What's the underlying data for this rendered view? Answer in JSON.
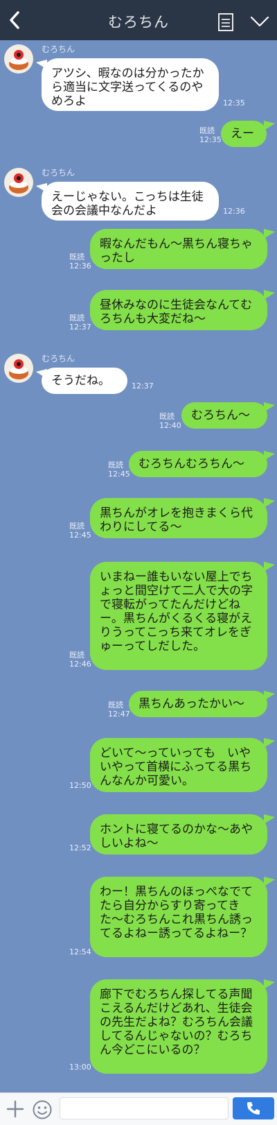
{
  "header": {
    "title": "むろちん",
    "back_icon": "chevron-left-icon",
    "menu_icon": "note-icon",
    "collapse_icon": "chevron-down-icon"
  },
  "colors": {
    "background": "#7190c2",
    "header": "#2a3546",
    "outgoing_bubble": "#84e04a",
    "incoming_bubble": "#ffffff",
    "send_button": "#2f7be0"
  },
  "messages": [
    {
      "dir": "in",
      "sender": "むろちん",
      "text": "アツシ、暇なのは分かったから適当に文字送ってくるのやめろよ",
      "time": "12:35"
    },
    {
      "dir": "out",
      "read": "既読",
      "text": "えー",
      "time": "12:35"
    },
    {
      "dir": "in",
      "sender": "むろちん",
      "text": "えーじゃない。こっちは生徒会の会議中なんだよ",
      "time": "12:36"
    },
    {
      "dir": "out",
      "read": "既読",
      "text": "暇なんだもん〜黒ちん寝ちゃったし",
      "time": "12:36"
    },
    {
      "dir": "out",
      "read": "既読",
      "text": "昼休みなのに生徒会なんてむろちんも大変だね〜",
      "time": "12:37"
    },
    {
      "dir": "in",
      "sender": "むろちん",
      "text": "そうだね。",
      "time": "12:37"
    },
    {
      "dir": "out",
      "read": "既読",
      "text": "むろちん〜",
      "time": "12:40"
    },
    {
      "dir": "out",
      "read": "既読",
      "text": "むろちんむろちん〜",
      "time": "12:45"
    },
    {
      "dir": "out",
      "read": "既読",
      "text": "黒ちんがオレを抱きまくら代わりにしてる〜",
      "time": "12:45"
    },
    {
      "dir": "out",
      "read": "既読",
      "text": "いまねー誰もいない屋上でちょっと間空けて二人で大の字で寝転がってたんだけどねー。黒ちんがくるくる寝がえりうってこっち来てオレをぎゅーってしだした。",
      "time": "12:46"
    },
    {
      "dir": "out",
      "read": "既読",
      "text": "黒ちんあったかい〜",
      "time": "12:47"
    },
    {
      "dir": "out",
      "read": "",
      "text": "どいて〜っていっても　いやいやって首横にふってる黒ちんなんか可愛い。",
      "time": "12:50"
    },
    {
      "dir": "out",
      "read": "",
      "text": "ホントに寝てるのかな〜あやしいよね〜",
      "time": "12:52"
    },
    {
      "dir": "out",
      "read": "",
      "text": "わー！黒ちんのほっぺなでてたら自分からすり寄ってきた〜むろちんこれ黒ちん誘ってるよねー誘ってるよねー？",
      "time": "12:54"
    },
    {
      "dir": "out",
      "read": "",
      "text": "廊下でむろちん探してる声聞こえるんだけどあれ、生徒会の先生だよね？むろちん会議してるんじゃないの？むろちん今どこにいるの？",
      "time": "13:00"
    }
  ],
  "footer": {
    "plus_icon": "plus-icon",
    "emoji_icon": "smiley-icon",
    "input_placeholder": "",
    "call_icon": "phone-icon"
  }
}
